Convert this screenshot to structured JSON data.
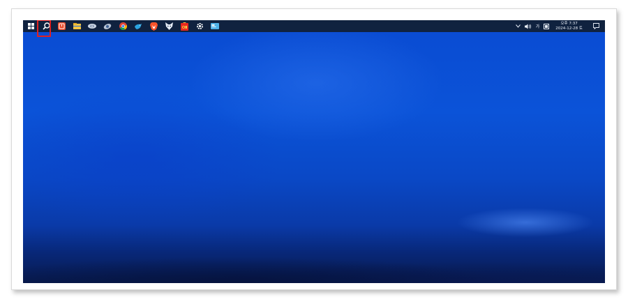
{
  "taskbar": {
    "pinned": [
      {
        "name": "start-button",
        "icon": "windows-logo-icon"
      },
      {
        "name": "search-button",
        "icon": "search-icon",
        "highlighted": true
      },
      {
        "name": "app-red-power",
        "icon": "power-app-icon"
      },
      {
        "name": "file-explorer",
        "icon": "folder-icon"
      },
      {
        "name": "app-disk",
        "icon": "disk-icon"
      },
      {
        "name": "app-satellite",
        "icon": "satellite-icon"
      },
      {
        "name": "chrome",
        "icon": "chrome-icon"
      },
      {
        "name": "app-bird",
        "icon": "bird-icon"
      },
      {
        "name": "brave",
        "icon": "brave-lion-icon"
      },
      {
        "name": "app-fox",
        "icon": "fox-icon"
      },
      {
        "name": "app-ot",
        "icon": "ot-app-icon"
      },
      {
        "name": "settings",
        "icon": "gear-icon"
      },
      {
        "name": "app-window",
        "icon": "window-app-icon"
      }
    ],
    "tray": {
      "ime_label": "가",
      "time": "오후 7:37",
      "date": "2024-12-28 토"
    },
    "colors": {
      "taskbar_bg": "#10223f",
      "highlight": "#e02020",
      "wallpaper_blue": "#0b53d8"
    }
  }
}
